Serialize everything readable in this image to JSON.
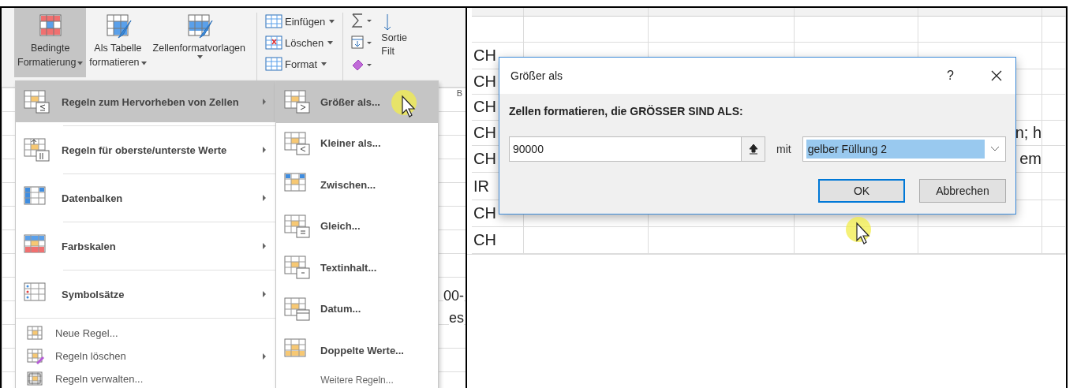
{
  "ribbon": {
    "styles_group": [
      {
        "label_lines": [
          "Bedingte",
          "Formatierung"
        ],
        "dropdown": true,
        "selected": true
      },
      {
        "label_lines": [
          "Als Tabelle",
          "formatieren"
        ],
        "dropdown": true,
        "selected": false
      },
      {
        "label_lines": [
          "Zellenformatvorlagen"
        ],
        "dropdown": true,
        "selected": false
      }
    ],
    "cells_group": [
      {
        "label": "Einfügen",
        "dropdown": true
      },
      {
        "label": "Löschen",
        "dropdown": true
      },
      {
        "label": "Format",
        "dropdown": true
      }
    ],
    "editing_group": {
      "sort_label_lines": [
        "Sortie",
        "Filt"
      ],
      "group_label": "B"
    }
  },
  "menu": {
    "items": [
      {
        "kind": "large",
        "label": "Regeln zum Hervorheben von Zellen",
        "has_submenu": true,
        "selected": true
      },
      {
        "kind": "large",
        "label": "Regeln für oberste/unterste Werte",
        "has_submenu": true,
        "selected": false
      },
      {
        "kind": "large",
        "label": "Datenbalken",
        "has_submenu": true,
        "selected": false
      },
      {
        "kind": "large",
        "label": "Farbskalen",
        "has_submenu": true,
        "selected": false
      },
      {
        "kind": "large",
        "label": "Symbolsätze",
        "has_submenu": true,
        "selected": false
      },
      {
        "kind": "small",
        "label": "Neue Regel...",
        "has_submenu": false,
        "selected": false
      },
      {
        "kind": "small",
        "label": "Regeln löschen",
        "has_submenu": true,
        "selected": false
      },
      {
        "kind": "small",
        "label": "Regeln verwalten...",
        "has_submenu": false,
        "selected": false
      }
    ]
  },
  "submenu": {
    "items": [
      {
        "label": "Größer als...",
        "selected": true
      },
      {
        "label": "Kleiner als...",
        "selected": false
      },
      {
        "label": "Zwischen...",
        "selected": false
      },
      {
        "label": "Gleich...",
        "selected": false
      },
      {
        "label": "Textinhalt...",
        "selected": false
      },
      {
        "label": "Datum...",
        "selected": false
      },
      {
        "label": "Doppelte Werte...",
        "selected": false
      }
    ],
    "footer": "Weitere Regeln..."
  },
  "sheet_left": {
    "fragments": [
      "00-",
      "es"
    ]
  },
  "sheet_right": {
    "rows": [
      {
        "label": "CH"
      },
      {
        "label": "CH"
      },
      {
        "label": "CH"
      },
      {
        "label": "CH",
        "trailing": "n; h"
      },
      {
        "label": "CH",
        "trailing": "em"
      },
      {
        "label": "IR"
      },
      {
        "label": "CH"
      },
      {
        "label": "CH"
      }
    ]
  },
  "dialog": {
    "title": "Größer als",
    "help": "?",
    "prompt": "Zellen formatieren, die GRÖSSER SIND ALS:",
    "value": "90000",
    "with_label": "mit",
    "format": "gelber Füllung 2",
    "buttons": [
      {
        "label": "OK",
        "default": true
      },
      {
        "label": "Abbrechen",
        "default": false
      }
    ]
  }
}
